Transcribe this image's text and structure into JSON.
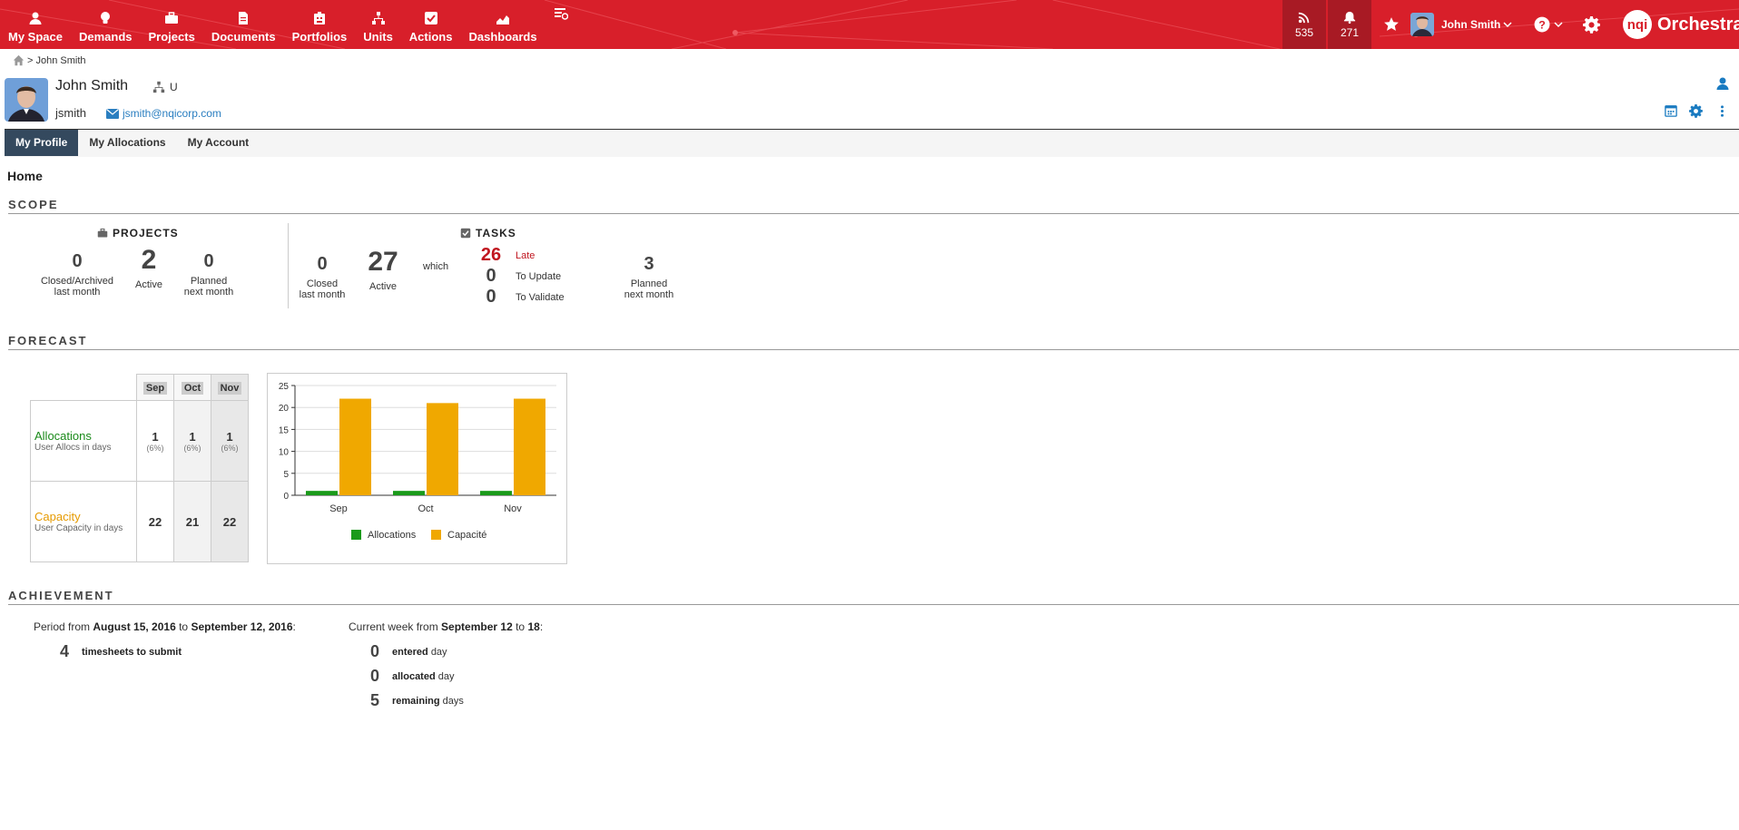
{
  "nav": {
    "items": [
      {
        "label": "My Space",
        "icon": "user-icon"
      },
      {
        "label": "Demands",
        "icon": "lightbulb-icon"
      },
      {
        "label": "Projects",
        "icon": "briefcase-icon"
      },
      {
        "label": "Documents",
        "icon": "document-icon"
      },
      {
        "label": "Portfolios",
        "icon": "portfolio-icon"
      },
      {
        "label": "Units",
        "icon": "sitemap-icon"
      },
      {
        "label": "Actions",
        "icon": "checkbox-icon"
      },
      {
        "label": "Dashboards",
        "icon": "area-chart-icon"
      }
    ],
    "extra_icon": "list-icon",
    "feed_count": "535",
    "notif_count": "271",
    "user_name": "John Smith",
    "logo_mark": "nqi",
    "logo_text": "Orchestra"
  },
  "breadcrumb": {
    "current": "John Smith",
    "separator": ">"
  },
  "profile": {
    "name": "John Smith",
    "unit": "U",
    "login": "jsmith",
    "email": "jsmith@nqicorp.com"
  },
  "tabs": [
    {
      "label": "My Profile",
      "active": true
    },
    {
      "label": "My Allocations",
      "active": false
    },
    {
      "label": "My Account",
      "active": false
    }
  ],
  "page_title": "Home",
  "scope": {
    "title": "SCOPE",
    "projects": {
      "title": "PROJECTS",
      "closed": {
        "value": "0",
        "label1": "Closed/Archived",
        "label2": "last month"
      },
      "active": {
        "value": "2",
        "label": "Active"
      },
      "planned": {
        "value": "0",
        "label1": "Planned",
        "label2": "next month"
      }
    },
    "tasks": {
      "title": "TASKS",
      "closed": {
        "value": "0",
        "label1": "Closed",
        "label2": "last month"
      },
      "active": {
        "value": "27",
        "label": "Active"
      },
      "which": "which",
      "late": {
        "value": "26",
        "label": "Late"
      },
      "to_update": {
        "value": "0",
        "label": "To Update"
      },
      "to_validate": {
        "value": "0",
        "label": "To Validate"
      },
      "planned": {
        "value": "3",
        "label1": "Planned",
        "label2": "next month"
      }
    }
  },
  "forecast": {
    "title": "FORECAST",
    "months": [
      "Sep",
      "Oct",
      "Nov"
    ],
    "allocations": {
      "label": "Allocations",
      "sub": "User Allocs in days",
      "values": [
        "1",
        "1",
        "1"
      ],
      "pcts": [
        "(6%)",
        "(6%)",
        "(6%)"
      ]
    },
    "capacity": {
      "label": "Capacity",
      "sub": "User Capacity in days",
      "values": [
        "22",
        "21",
        "22"
      ]
    }
  },
  "chart_data": {
    "type": "bar",
    "categories": [
      "Sep",
      "Oct",
      "Nov"
    ],
    "series": [
      {
        "name": "Allocations",
        "values": [
          1,
          1,
          1
        ],
        "color": "#1a9a1a"
      },
      {
        "name": "Capacité",
        "values": [
          22,
          21,
          22
        ],
        "color": "#f0a800"
      }
    ],
    "yticks": [
      0,
      5,
      10,
      15,
      20,
      25
    ],
    "ylim": [
      0,
      25
    ],
    "legend": "bottom"
  },
  "achievement": {
    "title": "ACHIEVEMENT",
    "period": {
      "prefix": "Period from",
      "start": "August 15, 2016",
      "to": "to",
      "end": "September 12, 2016",
      "suffix": ":"
    },
    "week": {
      "prefix": "Current week from",
      "start": "September 12",
      "to": "to",
      "end": "18",
      "suffix": ":"
    },
    "timesheets": {
      "value": "4",
      "label": "timesheets to submit"
    },
    "entered": {
      "value": "0",
      "bold": "entered",
      "rest": "day"
    },
    "allocated": {
      "value": "0",
      "bold": "allocated",
      "rest": "day"
    },
    "remaining": {
      "value": "5",
      "bold": "remaining",
      "rest": "days"
    }
  }
}
